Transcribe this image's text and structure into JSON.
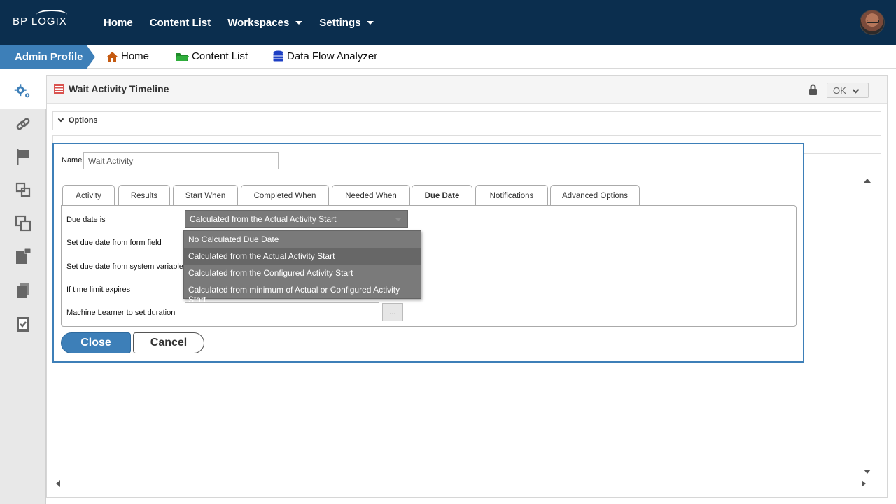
{
  "brand": {
    "logo_text": "BP LOGIX"
  },
  "topnav": {
    "items": [
      {
        "label": "Home",
        "has_caret": false
      },
      {
        "label": "Content List",
        "has_caret": false
      },
      {
        "label": "Workspaces",
        "has_caret": true
      },
      {
        "label": "Settings",
        "has_caret": true
      }
    ]
  },
  "secondary_nav": {
    "active": "Admin Profile",
    "items": [
      {
        "label": "Home",
        "icon": "home-icon"
      },
      {
        "label": "Content List",
        "icon": "folder-icon"
      },
      {
        "label": "Data Flow Analyzer",
        "icon": "database-icon"
      }
    ]
  },
  "sidebar": {
    "icons": [
      "gears-icon",
      "link-icon",
      "flag-icon",
      "layers-icon",
      "copy-icon",
      "lock-document-icon",
      "documents-icon",
      "checklist-icon"
    ]
  },
  "window": {
    "title": "Wait Activity Timeline",
    "ok_label": "OK",
    "options_label": "Options"
  },
  "dialog": {
    "name_label": "Name",
    "name_value": "Wait Activity",
    "tabs": [
      "Activity",
      "Results",
      "Start When",
      "Completed When",
      "Needed When",
      "Due Date",
      "Notifications",
      "Advanced Options"
    ],
    "active_tab": "Due Date",
    "rows": {
      "due_date_label": "Due date is",
      "form_field_label": "Set due date from form field",
      "system_var_label": "Set due date from system variable",
      "time_limit_label": "If time limit expires",
      "ml_label": "Machine Learner to set duration"
    },
    "selected": "Calculated from the Actual Activity Start",
    "options": [
      "No Calculated Due Date",
      "Calculated from the Actual Activity Start",
      "Calculated from the Configured Activity Start",
      "Calculated from minimum of Actual or Configured Activity Start"
    ],
    "ellipsis_label": "...",
    "close_label": "Close",
    "cancel_label": "Cancel"
  },
  "colors": {
    "topbar": "#0b2e4e",
    "accent": "#3d7fb8",
    "dropdown": "#7a7a7a"
  }
}
